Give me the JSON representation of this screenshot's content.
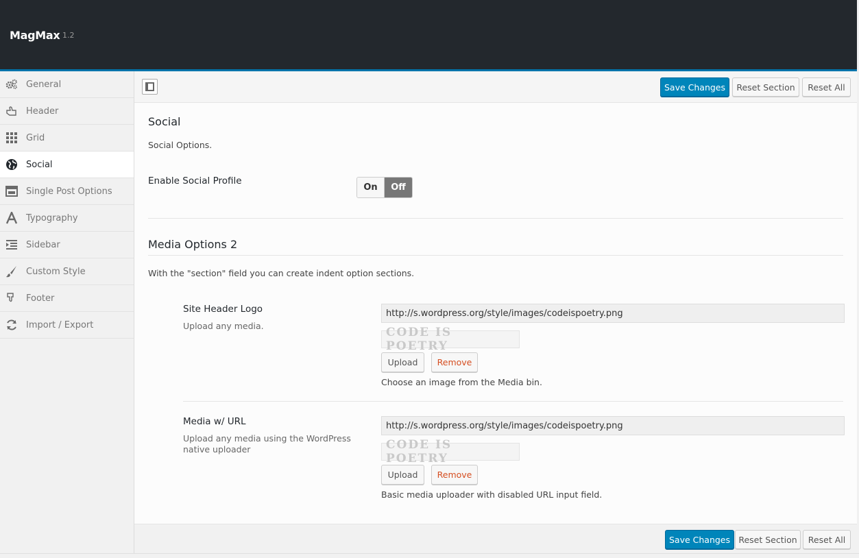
{
  "header": {
    "brand": "MagMax",
    "version": "1.2"
  },
  "sidebar": {
    "items": [
      {
        "label": "General",
        "icon": "gears-icon"
      },
      {
        "label": "Header",
        "icon": "hand-pointer-icon"
      },
      {
        "label": "Grid",
        "icon": "grid-icon"
      },
      {
        "label": "Social",
        "icon": "globe-icon",
        "active": true
      },
      {
        "label": "Single Post Options",
        "icon": "window-icon"
      },
      {
        "label": "Typography",
        "icon": "font-icon"
      },
      {
        "label": "Sidebar",
        "icon": "indent-icon"
      },
      {
        "label": "Custom Style",
        "icon": "brush-icon"
      },
      {
        "label": "Footer",
        "icon": "hand-down-icon"
      },
      {
        "label": "Import / Export",
        "icon": "refresh-icon"
      }
    ]
  },
  "toolbar": {
    "save_label": "Save Changes",
    "reset_section_label": "Reset Section",
    "reset_all_label": "Reset All"
  },
  "social": {
    "title": "Social",
    "description": "Social Options.",
    "enable_label": "Enable Social Profile",
    "switch_on": "On",
    "switch_off": "Off",
    "switch_state": "Off"
  },
  "media": {
    "title": "Media Options 2",
    "description": "With the \"section\" field you can create indent option sections.",
    "fields": [
      {
        "label": "Site Header Logo",
        "sub": "Upload any media.",
        "url": "http://s.wordpress.org/style/images/codeispoetry.png",
        "preview_text": "CODE IS POETRY",
        "upload_label": "Upload",
        "remove_label": "Remove",
        "help": "Choose an image from the Media bin."
      },
      {
        "label": "Media w/ URL",
        "sub": "Upload any media using the WordPress native uploader",
        "url": "http://s.wordpress.org/style/images/codeispoetry.png",
        "preview_text": "CODE IS POETRY",
        "upload_label": "Upload",
        "remove_label": "Remove",
        "help": "Basic media uploader with disabled URL input field."
      }
    ]
  },
  "colors": {
    "primary": "#0085ba",
    "header_bg": "#23282d",
    "accent_line": "#0073aa",
    "remove": "#d54e21"
  }
}
